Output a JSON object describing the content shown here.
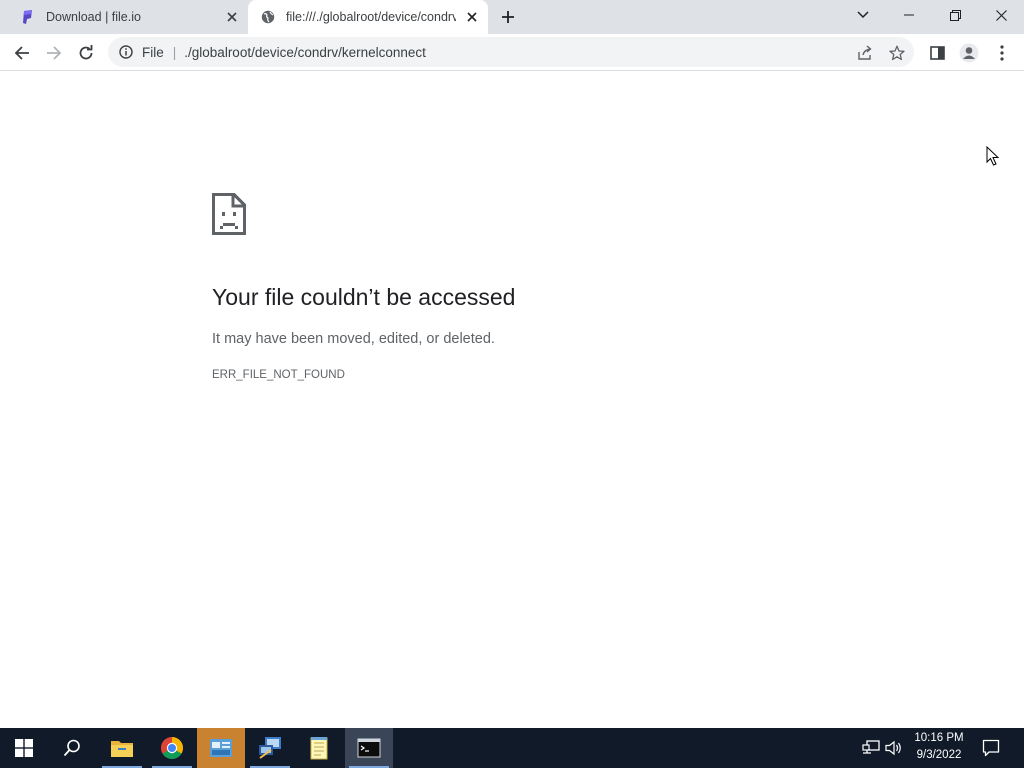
{
  "browser": {
    "tabs": [
      {
        "title": "Download | file.io",
        "favicon": "fileio-logo-icon",
        "active": false
      },
      {
        "title": "file:///./globalroot/device/condrv/kernelconnect",
        "favicon": "globe-icon",
        "active": true
      }
    ],
    "address_bar": {
      "scheme_label": "File",
      "separator": "|",
      "url": "./globalroot/device/condrv/kernelconnect"
    }
  },
  "error_page": {
    "icon": "sad-file-icon",
    "heading": "Your file couldn’t be accessed",
    "message": "It may have been moved, edited, or deleted.",
    "code": "ERR_FILE_NOT_FOUND"
  },
  "taskbar": {
    "apps": [
      "start-icon",
      "search-icon",
      "file-explorer-icon",
      "chrome-icon",
      "control-panel-icon",
      "network-app-icon",
      "notepad-icon",
      "command-prompt-icon"
    ],
    "clock": {
      "time": "10:16 PM",
      "date": "9/3/2022"
    }
  },
  "colors": {
    "tabstrip": "#dee1e6",
    "omnibox": "#f1f3f4",
    "taskbar": "#101a29",
    "taskbar_highlight": "#c88230",
    "heading": "#202124",
    "secondary_text": "#5f6368"
  }
}
